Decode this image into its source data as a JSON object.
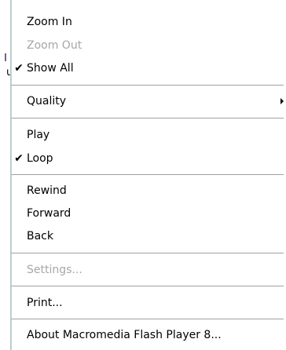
{
  "background_fragment": {
    "edge_text": "u"
  },
  "menu": {
    "items": [
      {
        "label": "Zoom In",
        "enabled": true,
        "checked": false,
        "submenu": false
      },
      {
        "label": "Zoom Out",
        "enabled": false,
        "checked": false,
        "submenu": false
      },
      {
        "label": "Show All",
        "enabled": true,
        "checked": true,
        "submenu": false
      },
      {
        "label": "Quality",
        "enabled": true,
        "checked": false,
        "submenu": true
      },
      {
        "label": "Play",
        "enabled": true,
        "checked": false,
        "submenu": false
      },
      {
        "label": "Loop",
        "enabled": true,
        "checked": true,
        "submenu": false
      },
      {
        "label": "Rewind",
        "enabled": true,
        "checked": false,
        "submenu": false
      },
      {
        "label": "Forward",
        "enabled": true,
        "checked": false,
        "submenu": false
      },
      {
        "label": "Back",
        "enabled": true,
        "checked": false,
        "submenu": false
      },
      {
        "label": "Settings...",
        "enabled": false,
        "checked": false,
        "submenu": false
      },
      {
        "label": "Print...",
        "enabled": true,
        "checked": false,
        "submenu": false
      },
      {
        "label": "About Macromedia Flash Player 8...",
        "enabled": true,
        "checked": false,
        "submenu": false
      }
    ],
    "check_glyph": "✔",
    "submenu_glyph": "▶",
    "colors": {
      "text": "#000000",
      "disabled_text": "#a7a7a7",
      "separator": "#a0a0a0",
      "background": "#ffffff"
    }
  }
}
